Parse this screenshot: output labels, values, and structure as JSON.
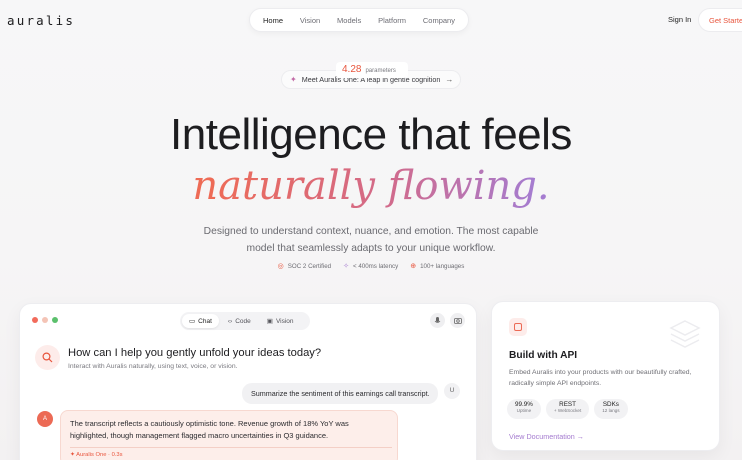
{
  "brand": {
    "logo": "auralis"
  },
  "nav": {
    "links": [
      "Home",
      "Vision",
      "Models",
      "Platform",
      "Company"
    ],
    "active": "Home",
    "sign_in": "Sign In",
    "cta": "Get Started"
  },
  "announcement": {
    "param_value": "4.28",
    "param_label": "parameters",
    "text": "Meet Auralis One: A leap in gentle cognition",
    "arrow": "→"
  },
  "hero": {
    "title": "Intelligence that feels",
    "accent": "naturally flowing.",
    "subtitle_line1": "Designed to understand context, nuance, and emotion. The most capable",
    "subtitle_line2": "model that seamlessly adapts to your unique workflow.",
    "badges": [
      "SOC 2 Certified",
      "< 400ms latency",
      "100+ languages"
    ]
  },
  "chat": {
    "tabs": [
      "Chat",
      "Code",
      "Vision"
    ],
    "active_tab": "Chat",
    "heading": "How can I help you gently unfold your ideas today?",
    "subheading": "Interact with Auralis naturally, using text, voice, or vision.",
    "user_avatar": "U",
    "user_message": "Summarize the sentiment of this earnings call transcript.",
    "ai_avatar": "A",
    "ai_message": "The transcript reflects a cautiously optimistic tone. Revenue growth of 18% YoY was highlighted, though management flagged macro uncertainties in Q3 guidance.",
    "ai_meta": "Auralis One · 0.3s",
    "colors": {
      "dot_red": "#f26b5b",
      "dot_yellow": "#f4c4b6",
      "dot_green": "#5bc06c",
      "accent": "#e8553d"
    }
  },
  "api": {
    "title": "Build with API",
    "description": "Embed Auralis into your products with our beautifully crafted, radically simple API endpoints.",
    "stats": [
      {
        "value": "99.9%",
        "label": "Uptime"
      },
      {
        "value": "REST",
        "label": "+ WebSocket"
      },
      {
        "value": "SDKs",
        "label": "12 langs"
      }
    ],
    "link": "View Documentation →"
  }
}
